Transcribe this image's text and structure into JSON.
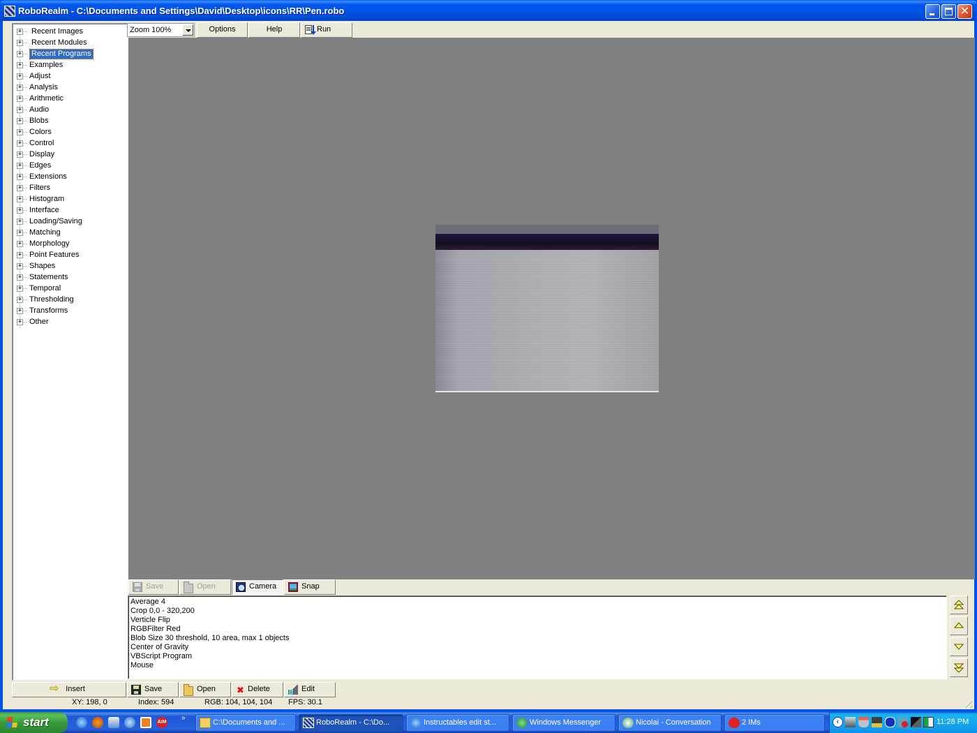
{
  "window": {
    "title": "RoboRealm - C:\\Documents and Settings\\David\\Desktop\\icons\\RR\\Pen.robo",
    "controls": {
      "minimize": "minimize",
      "maximize": "maximize",
      "close": "close"
    }
  },
  "tree": {
    "items": [
      {
        "label": "Recent Images",
        "selected": false
      },
      {
        "label": "Recent Modules",
        "selected": false
      },
      {
        "label": "Recent Programs",
        "selected": true
      },
      {
        "label": "Examples"
      },
      {
        "label": "Adjust"
      },
      {
        "label": "Analysis"
      },
      {
        "label": "Arithmetic"
      },
      {
        "label": "Audio"
      },
      {
        "label": "Blobs"
      },
      {
        "label": "Colors"
      },
      {
        "label": "Control"
      },
      {
        "label": "Display"
      },
      {
        "label": "Edges"
      },
      {
        "label": "Extensions"
      },
      {
        "label": "Filters"
      },
      {
        "label": "Histogram"
      },
      {
        "label": "Interface"
      },
      {
        "label": "Loading/Saving"
      },
      {
        "label": "Matching"
      },
      {
        "label": "Morphology"
      },
      {
        "label": "Point Features"
      },
      {
        "label": "Shapes"
      },
      {
        "label": "Statements"
      },
      {
        "label": "Temporal"
      },
      {
        "label": "Thresholding"
      },
      {
        "label": "Transforms"
      },
      {
        "label": "Other"
      }
    ],
    "expander_glyph": "+"
  },
  "toolbar": {
    "zoom_value": "Zoom 100%",
    "options_label": "Options",
    "help_label": "Help",
    "run_label": "Run"
  },
  "image_toolbar": {
    "save_label": "Save",
    "open_label": "Open",
    "camera_label": "Camera",
    "snap_label": "Snap"
  },
  "program": {
    "items": [
      "Average 4",
      "Crop 0,0 - 320,200",
      "Verticle Flip",
      "RGBFilter Red",
      "Blob Size 30 threshold, 10 area, max 1 objects",
      "Center of Gravity",
      "VBScript Program",
      "Mouse"
    ]
  },
  "program_toolbar": {
    "insert_label": "Insert",
    "save_label": "Save",
    "open_label": "Open",
    "delete_label": "Delete",
    "edit_label": "Edit"
  },
  "status": {
    "xy": "XY: 198, 0",
    "index": "Index: 594",
    "rgb": "RGB: 104, 104, 104",
    "fps": "FPS: 30.1"
  },
  "taskbar": {
    "start_label": "start",
    "quick_launch": [
      "internet-explorer-icon",
      "firefox-icon",
      "outlook-icon",
      "skype-icon",
      "clock-icon",
      "aim-icon"
    ],
    "more_glyph": "»",
    "tasks": [
      {
        "label": "C:\\Documents and ...",
        "icon": "folder-icon"
      },
      {
        "label": "RoboRealm - C:\\Do...",
        "icon": "roborealm-icon",
        "active": true
      },
      {
        "label": "Instructables edit st...",
        "icon": "internet-explorer-icon"
      },
      {
        "label": "Windows Messenger",
        "icon": "messenger-icon"
      },
      {
        "label": "Nicolai - Conversation",
        "icon": "conversation-icon"
      },
      {
        "label": "2 IMs",
        "icon": "im-icon"
      }
    ],
    "tray_chevron": "‹",
    "clock": "11:28 PM"
  },
  "colors": {
    "title_blue": "#0054e3",
    "selection": "#316ac5",
    "viewport_gray": "#808080",
    "face": "#ece9d8"
  }
}
